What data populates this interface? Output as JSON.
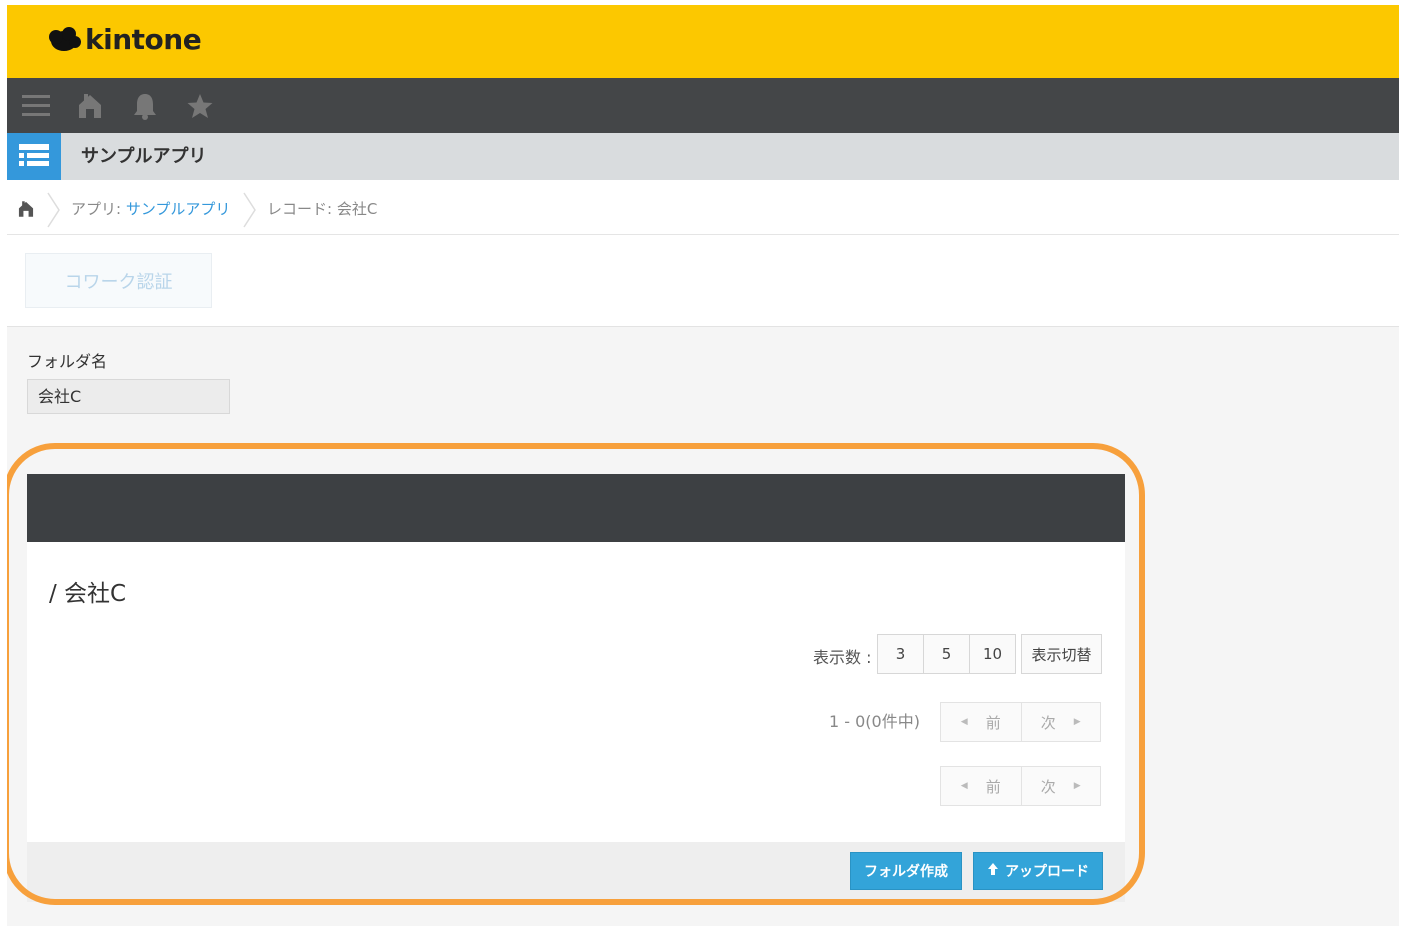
{
  "header": {
    "brand": "kintone",
    "brand_color": "#fcc800"
  },
  "nav": {
    "icons": [
      "menu-icon",
      "home-icon",
      "bell-icon",
      "star-icon"
    ]
  },
  "app": {
    "title": "サンプルアプリ",
    "icon": "list-icon"
  },
  "breadcrumb": {
    "app_prefix": "アプリ: ",
    "app_name": "サンプルアプリ",
    "record": "レコード: 会社C"
  },
  "toolbar": {
    "cowork_button": "コワーク認証"
  },
  "folder_field": {
    "label": "フォルダ名",
    "value": "会社C"
  },
  "file_panel": {
    "path": "/ 会社C",
    "display_count_label": "表示数 :",
    "display_counts": [
      "3",
      "5",
      "10"
    ],
    "toggle_view_button": "表示切替",
    "range_text": "1 - 0(0件中)",
    "prev_label": "前",
    "next_label": "次",
    "create_folder_button": "フォルダ作成",
    "upload_button": "アップロード"
  },
  "colors": {
    "accent_blue": "#33a4d9",
    "highlight_orange": "#f7a03c",
    "panel_header": "#3d4043"
  }
}
